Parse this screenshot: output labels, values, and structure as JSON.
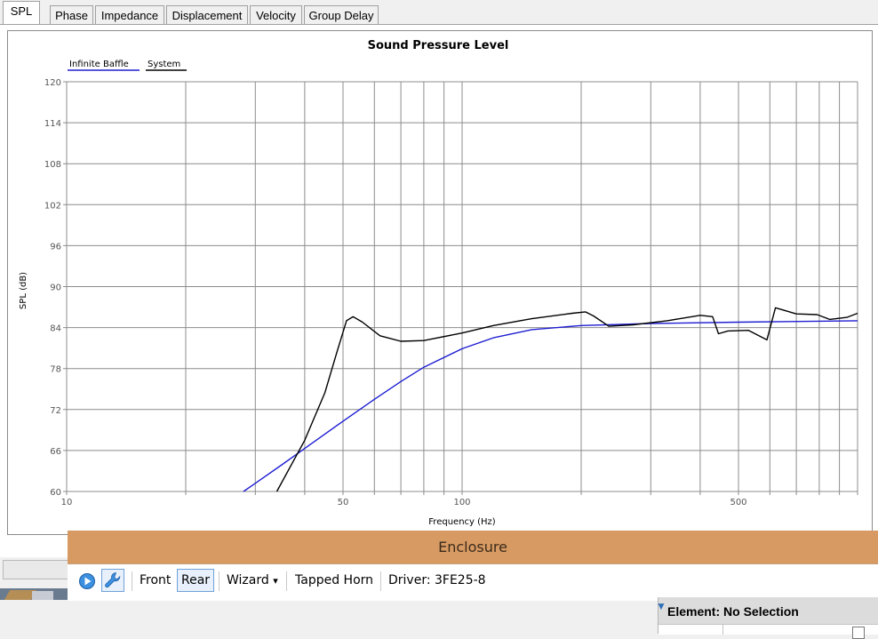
{
  "tabs": [
    {
      "label": "SPL",
      "active": true
    },
    {
      "label": "Phase",
      "active": false
    },
    {
      "label": "Impedance",
      "active": false
    },
    {
      "label": "Displacement",
      "active": false
    },
    {
      "label": "Velocity",
      "active": false
    },
    {
      "label": "Group Delay",
      "active": false
    }
  ],
  "chart_data": {
    "type": "line",
    "title": "Sound Pressure Level",
    "xlabel": "Frequency (Hz)",
    "ylabel": "SPL (dB)",
    "x_scale": "log",
    "xlim": [
      10,
      1000
    ],
    "ylim": [
      60,
      120
    ],
    "x_tick_labels": [
      "10",
      "50",
      "100",
      "500"
    ],
    "y_ticks": [
      60,
      66,
      72,
      78,
      84,
      90,
      96,
      102,
      108,
      114,
      120
    ],
    "grid": true,
    "legend_position": "top-left",
    "series": [
      {
        "name": "Infinite Baffle",
        "color": "#1f1fd2",
        "points": [
          [
            28,
            60
          ],
          [
            30,
            61.2
          ],
          [
            35,
            63.9
          ],
          [
            40,
            66.3
          ],
          [
            50,
            70.3
          ],
          [
            60,
            73.5
          ],
          [
            70,
            76.1
          ],
          [
            80,
            78.2
          ],
          [
            100,
            80.9
          ],
          [
            120,
            82.5
          ],
          [
            150,
            83.7
          ],
          [
            200,
            84.3
          ],
          [
            300,
            84.6
          ],
          [
            500,
            84.8
          ],
          [
            1000,
            85.0
          ]
        ]
      },
      {
        "name": "System",
        "color": "#000000",
        "points": [
          [
            34,
            60
          ],
          [
            40,
            67.5
          ],
          [
            45,
            74.5
          ],
          [
            48,
            80
          ],
          [
            51,
            85
          ],
          [
            53,
            85.6
          ],
          [
            56,
            84.8
          ],
          [
            62,
            82.8
          ],
          [
            70,
            82
          ],
          [
            80,
            82.1
          ],
          [
            100,
            83.2
          ],
          [
            120,
            84.3
          ],
          [
            150,
            85.3
          ],
          [
            190,
            86.1
          ],
          [
            205,
            86.3
          ],
          [
            215,
            85.7
          ],
          [
            235,
            84.2
          ],
          [
            270,
            84.4
          ],
          [
            330,
            85
          ],
          [
            400,
            85.8
          ],
          [
            430,
            85.6
          ],
          [
            445,
            83.1
          ],
          [
            470,
            83.5
          ],
          [
            530,
            83.6
          ],
          [
            590,
            82.2
          ],
          [
            620,
            86.9
          ],
          [
            700,
            86
          ],
          [
            790,
            85.9
          ],
          [
            850,
            85.2
          ],
          [
            940,
            85.5
          ],
          [
            1000,
            86.1
          ]
        ]
      }
    ]
  },
  "enclosure": {
    "title": "Enclosure",
    "toolbar": {
      "front_label": "Front",
      "rear_label": "Rear",
      "wizard_label": "Wizard",
      "wizard_arrow": "▾",
      "horn_label": "Tapped Horn",
      "driver_label": "Driver: 3FE25-8"
    },
    "element_panel_title": "Element: No Selection"
  }
}
